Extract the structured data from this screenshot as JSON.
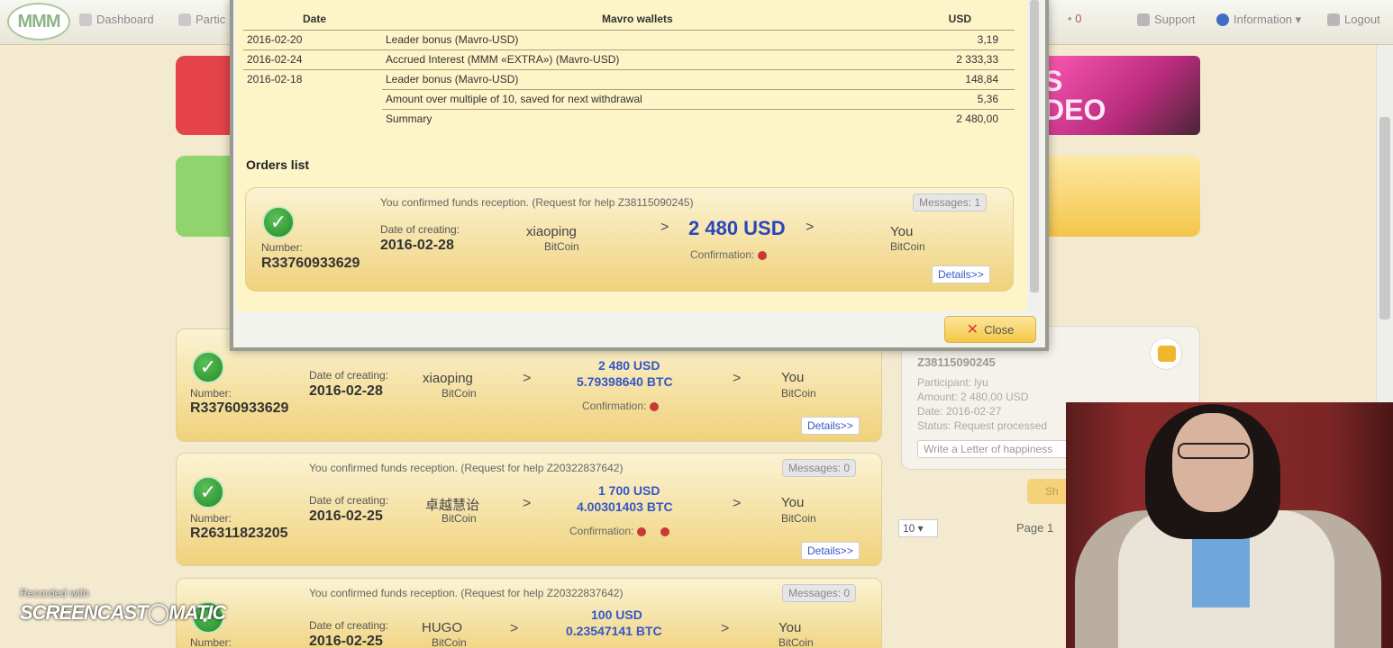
{
  "nav": {
    "logo": "MMM",
    "dashboard": "Dashboard",
    "participants": "Partic",
    "notifications_count": "0",
    "support": "Support",
    "information": "Information ▾",
    "logout": "Logout"
  },
  "banners": {
    "video_text": "S\nDEO"
  },
  "modal": {
    "wallet_table": {
      "headers": [
        "Date",
        "Mavro wallets",
        "USD"
      ],
      "rows": [
        {
          "date": "2016-02-20",
          "wallet": "Leader bonus (Mavro-USD)",
          "usd": "3,19"
        },
        {
          "date": "2016-02-24",
          "wallet": "Accrued Interest (MMM «EXTRA») (Mavro-USD)",
          "usd": "2 333,33"
        },
        {
          "date": "2016-02-18",
          "wallet": "Leader bonus (Mavro-USD)",
          "usd": "148,84"
        },
        {
          "date": "",
          "wallet": "Amount over multiple of 10, saved for next withdrawal",
          "usd": "5,36"
        },
        {
          "date": "",
          "wallet": "Summary",
          "usd": "2 480,00"
        }
      ]
    },
    "orders_title": "Orders list",
    "order": {
      "status": "You confirmed funds reception. (Request for help Z38115090245)",
      "messages": "Messages: 1",
      "number_label": "Number:",
      "number": "R33760933629",
      "date_label": "Date of creating:",
      "date": "2016-02-28",
      "sender": "xiaoping",
      "sender_method": "BitCoin",
      "arrow": ">",
      "amount": "2 480 USD",
      "confirmation": "Confirmation:",
      "receiver": "You",
      "receiver_method": "BitCoin",
      "details": "Details>>"
    },
    "close": "Close"
  },
  "orders": [
    {
      "status": "",
      "messages": "",
      "number_label": "Number:",
      "number": "R33760933629",
      "date_label": "Date of creating:",
      "date": "2016-02-28",
      "sender": "xiaoping",
      "sender_method": "BitCoin",
      "usd": "2 480 USD",
      "btc": "5.79398640 BTC",
      "confirmation": "Confirmation:",
      "receiver": "You",
      "receiver_method": "BitCoin",
      "details": "Details>>"
    },
    {
      "status": "You confirmed funds reception. (Request for help Z20322837642)",
      "messages": "Messages: 0",
      "number_label": "Number:",
      "number": "R26311823205",
      "date_label": "Date of creating:",
      "date": "2016-02-25",
      "sender": "卓越慧诒",
      "sender_method": "BitCoin",
      "usd": "1 700 USD",
      "btc": "4.00301403 BTC",
      "confirmation": "Confirmation:",
      "receiver": "You",
      "receiver_method": "BitCoin",
      "details": "Details>>"
    },
    {
      "status": "You confirmed funds reception. (Request for help Z20322837642)",
      "messages": "Messages: 0",
      "number_label": "Number:",
      "number": "",
      "date_label": "Date of creating:",
      "date": "2016-02-25",
      "sender": "HUGO",
      "sender_method": "BitCoin",
      "usd": "100 USD",
      "btc": "0.23547141 BTC",
      "confirmation": "",
      "receiver": "You",
      "receiver_method": "BitCoin",
      "details": ""
    }
  ],
  "side_panel": {
    "code": "Z38115090245",
    "participant": "Participant: lyu",
    "amount": "Amount: 2 480,00 USD",
    "date": "Date: 2016-02-27",
    "status": "Status: Request processed",
    "letter_button": "Write a Letter of happiness",
    "show_button": "Sh",
    "page_size": "10 ▾",
    "page_label": "Page 1"
  },
  "watermark": {
    "recorded_with": "Recorded with",
    "brand": "SCREENCAST◯MATIC"
  }
}
